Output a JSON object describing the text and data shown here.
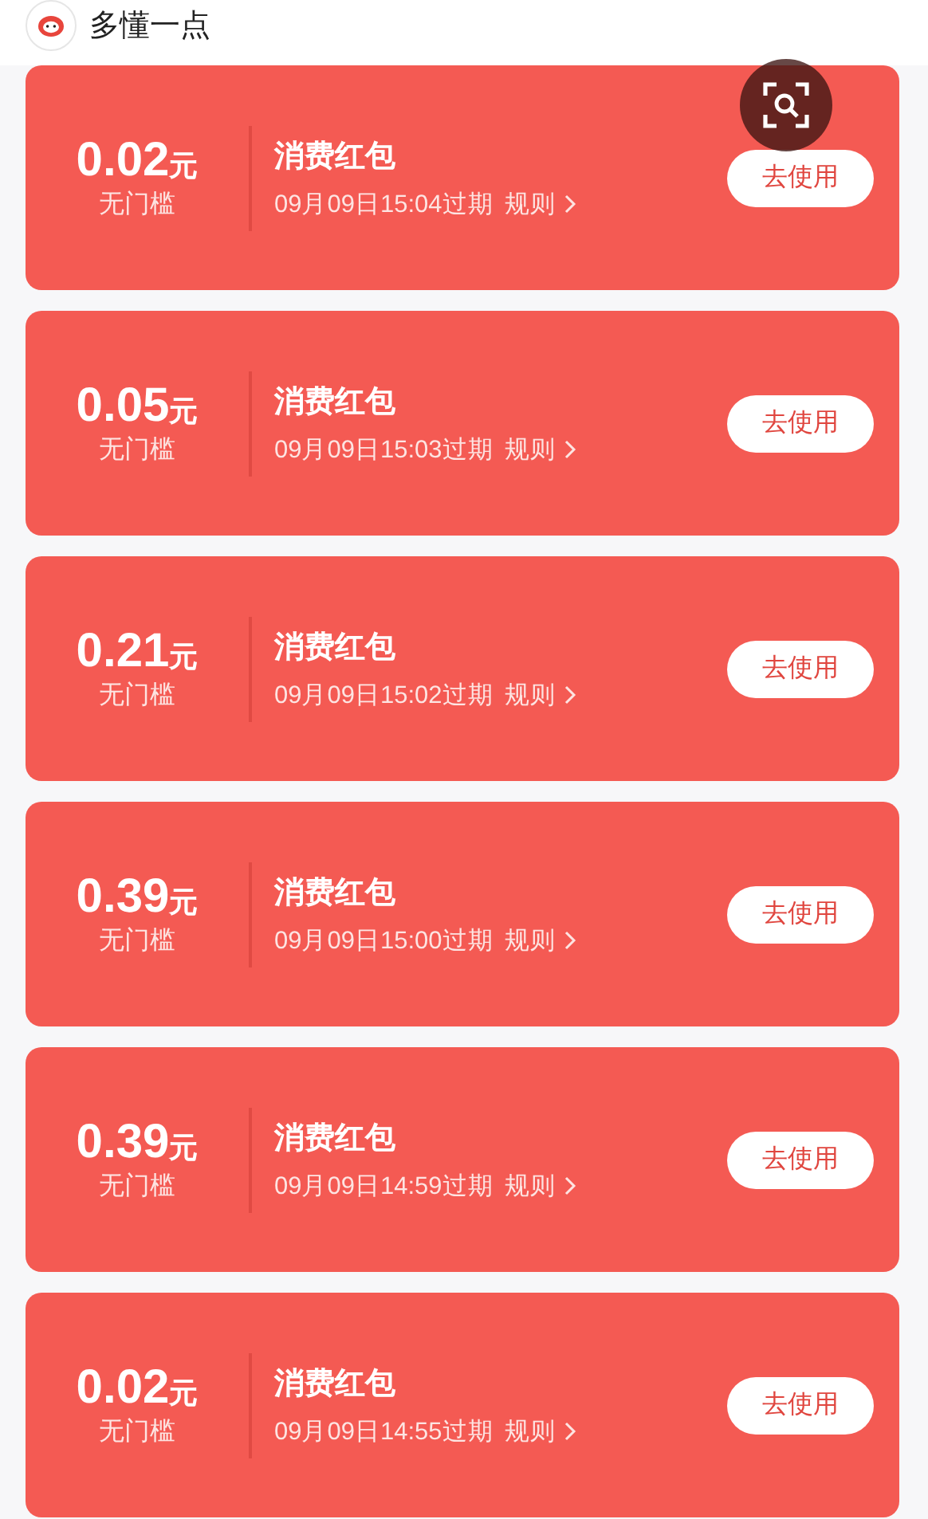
{
  "header": {
    "title": "多懂一点"
  },
  "coupons": [
    {
      "amount": "0.02",
      "unit": "元",
      "condition": "无门槛",
      "title": "消费红包",
      "expiry": "09月09日15:04过期",
      "rules": "规则",
      "button": "去使用"
    },
    {
      "amount": "0.05",
      "unit": "元",
      "condition": "无门槛",
      "title": "消费红包",
      "expiry": "09月09日15:03过期",
      "rules": "规则",
      "button": "去使用"
    },
    {
      "amount": "0.21",
      "unit": "元",
      "condition": "无门槛",
      "title": "消费红包",
      "expiry": "09月09日15:02过期",
      "rules": "规则",
      "button": "去使用"
    },
    {
      "amount": "0.39",
      "unit": "元",
      "condition": "无门槛",
      "title": "消费红包",
      "expiry": "09月09日15:00过期",
      "rules": "规则",
      "button": "去使用"
    },
    {
      "amount": "0.39",
      "unit": "元",
      "condition": "无门槛",
      "title": "消费红包",
      "expiry": "09月09日14:59过期",
      "rules": "规则",
      "button": "去使用"
    },
    {
      "amount": "0.02",
      "unit": "元",
      "condition": "无门槛",
      "title": "消费红包",
      "expiry": "09月09日14:55过期",
      "rules": "规则",
      "button": "去使用"
    }
  ]
}
